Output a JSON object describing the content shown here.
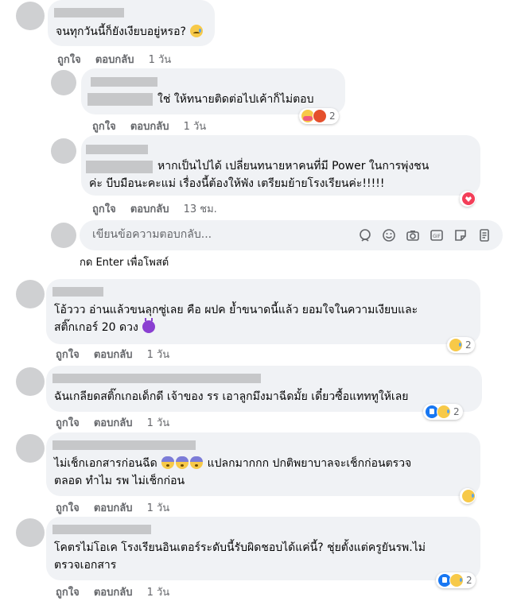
{
  "comments": [
    {
      "text_lines": [
        "จนทุกวันนี้ก็ยังเงียบอยู่หรอ?"
      ],
      "like": "ถูกใจ",
      "reply": "ตอบกลับ",
      "time": "1 วัน"
    },
    {
      "text_lines": [
        "ใช่ ให้ทนายติดต่อไปเค้าก็ไม่ตอบ"
      ],
      "like": "ถูกใจ",
      "reply": "ตอบกลับ",
      "time": "1 วัน",
      "reaction_count": "2"
    },
    {
      "text_lines": [
        "หากเป็นไปได้ เปลี่ยนทนายหาคนที่มี Power ในการพุ่งชน",
        "ค่ะ บีบมือนะคะแม่ เรื่องนี้ต้องให้พัง เตรียมย้ายโรงเรียนค่ะ!!!!!"
      ],
      "like": "ถูกใจ",
      "reply": "ตอบกลับ",
      "time": "13 ชม."
    },
    {
      "text_lines": [
        "โอ้ววว อ่านแล้วขนลุกซู่เลย คือ ผปค ย้ำขนาดนี้แล้ว ยอมใจในความเงียบและ",
        "สติ๊กเกอร์ 20 ดวง"
      ],
      "like": "ถูกใจ",
      "reply": "ตอบกลับ",
      "time": "1 วัน",
      "reaction_count": "2"
    },
    {
      "text_lines": [
        "ฉันเกลียดสติ๊กเกอเด็กดี เจ้าของ รร เอาลูกมึงมาฉีดมั้ย เดี๋ยวซื้อแทททูให้เลย"
      ],
      "like": "ถูกใจ",
      "reply": "ตอบกลับ",
      "time": "1 วัน",
      "reaction_count": "2"
    },
    {
      "text_lines": [
        "ไม่เช็กเอกสารก่อนฉีด",
        "แปลกมากกก ปกติพยาบาลจะเช็กก่อนตรวจ",
        "ตลอด ทำไม รพ ไม่เช็กก่อน"
      ],
      "like": "ถูกใจ",
      "reply": "ตอบกลับ",
      "time": "1 วัน"
    },
    {
      "text_lines": [
        "โคตรไม่โอเค โรงเรียนอินเตอร์ระดับนี้รับผิดชอบได้แค่นี้? ชุ่ยตั้งแต่ครูยันรพ.ไม่",
        "ตรวจเอกสาร"
      ],
      "like": "ถูกใจ",
      "reply": "ตอบกลับ",
      "time": "1 วัน",
      "reaction_count": "2"
    }
  ],
  "reply_box": {
    "placeholder": "เขียนข้อความตอบกลับ...",
    "hint": "กด Enter เพื่อโพสต์"
  },
  "tool_icons": [
    "avatar-sticker-icon",
    "emoji-icon",
    "camera-icon",
    "gif-icon",
    "sticker-icon",
    "more-icon"
  ]
}
